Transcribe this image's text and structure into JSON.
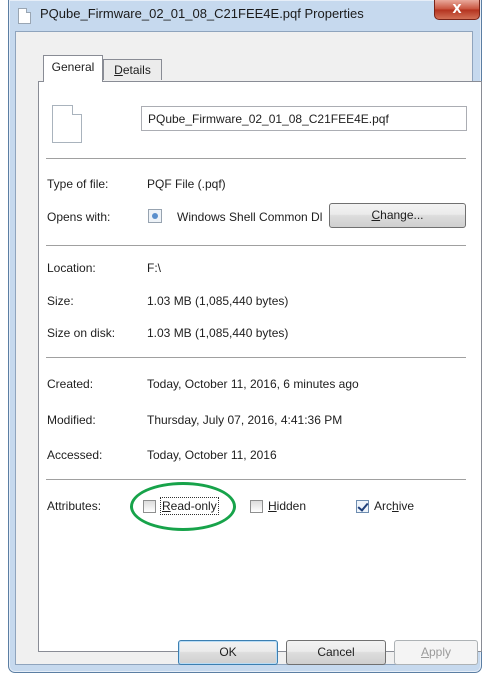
{
  "window": {
    "title": "PQube_Firmware_02_01_08_C21FEE4E.pqf Properties",
    "close_glyph": "X"
  },
  "tabs": [
    {
      "label": "General",
      "selected": true
    },
    {
      "label_prefix": "D",
      "label_rest": "etails",
      "selected": false
    }
  ],
  "file_name": "PQube_Firmware_02_01_08_C21FEE4E.pqf",
  "type_section": {
    "type_label": "Type of file:",
    "type_value": "PQF File (.pqf)",
    "opens_label": "Opens with:",
    "opens_value": "Windows Shell Common Dll",
    "change_button": {
      "underline": "C",
      "rest": "hange..."
    }
  },
  "location_section": {
    "location_label": "Location:",
    "location_value": "F:\\",
    "size_label": "Size:",
    "size_value": "1.03 MB (1,085,440 bytes)",
    "size_on_disk_label": "Size on disk:",
    "size_on_disk_value": "1.03 MB (1,085,440 bytes)"
  },
  "dates_section": {
    "created_label": "Created:",
    "created_value": "Today, October 11, 2016, 6 minutes ago",
    "modified_label": "Modified:",
    "modified_value": "Thursday, July 07, 2016, 4:41:36 PM",
    "accessed_label": "Accessed:",
    "accessed_value": "Today, October 11, 2016"
  },
  "attributes": {
    "label": "Attributes:",
    "read_only": {
      "underline": "R",
      "rest": "ead-only",
      "checked": false
    },
    "hidden": {
      "underline": "H",
      "rest": "idden",
      "checked": false
    },
    "archive": {
      "prefix": "Arc",
      "underline": "h",
      "rest": "ive",
      "checked": true
    }
  },
  "buttons": {
    "ok": "OK",
    "cancel": "Cancel",
    "apply": {
      "underline": "A",
      "rest": "pply",
      "enabled": false
    }
  },
  "colors": {
    "highlight": "#17a34a"
  }
}
